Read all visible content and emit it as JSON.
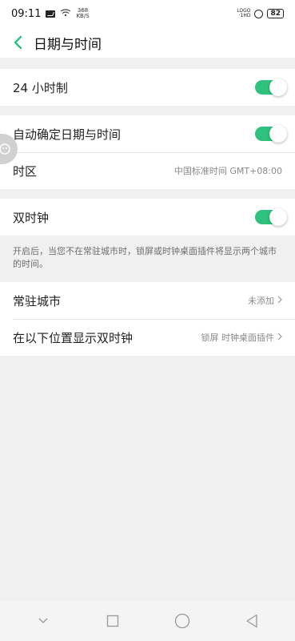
{
  "status_bar": {
    "time": "09:11",
    "speed_value": "368",
    "speed_unit": "KB/S",
    "network_top": "LOGO",
    "network_bottom": "·1HD",
    "battery": "82"
  },
  "header": {
    "title": "日期与时间"
  },
  "settings": {
    "hour24": {
      "label": "24 小时制",
      "enabled": true
    },
    "auto_time": {
      "label": "自动确定日期与时间",
      "enabled": true
    },
    "timezone": {
      "label": "时区",
      "value": "中国标准时间 GMT+08:00"
    },
    "dual_clock": {
      "label": "双时钟",
      "enabled": true
    },
    "dual_clock_desc": "开启后，当您不在常驻城市时，锁屏或时钟桌面插件将显示两个城市的时间。",
    "home_city": {
      "label": "常驻城市",
      "value": "未添加"
    },
    "display_location": {
      "label": "在以下位置显示双时钟",
      "value": "锁屏 时钟桌面插件"
    }
  },
  "colors": {
    "accent": "#2ec27e"
  }
}
